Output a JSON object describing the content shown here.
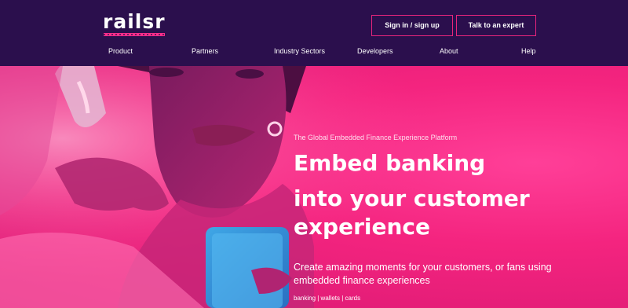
{
  "brand": {
    "logo_text": "railsr"
  },
  "header": {
    "signin_label": "Sign in / sign up",
    "expert_label": "Talk to an expert"
  },
  "nav": {
    "items": [
      {
        "label": "Product"
      },
      {
        "label": "Partners"
      },
      {
        "label": "Industry Sectors"
      },
      {
        "label": "Developers"
      },
      {
        "label": "About"
      },
      {
        "label": "Help"
      }
    ]
  },
  "hero": {
    "eyebrow": "The Global Embedded Finance Experience Platform",
    "headline_line1": "Embed banking",
    "headline_line2": "into your customer",
    "headline_line3": "experience",
    "subhead": "Create amazing moments for your customers, or fans using embedded finance experiences",
    "tags": "banking | wallets | cards"
  },
  "colors": {
    "header_bg": "#2b0f4d",
    "accent": "#e8247c",
    "hero_pink": "#f4247f"
  }
}
